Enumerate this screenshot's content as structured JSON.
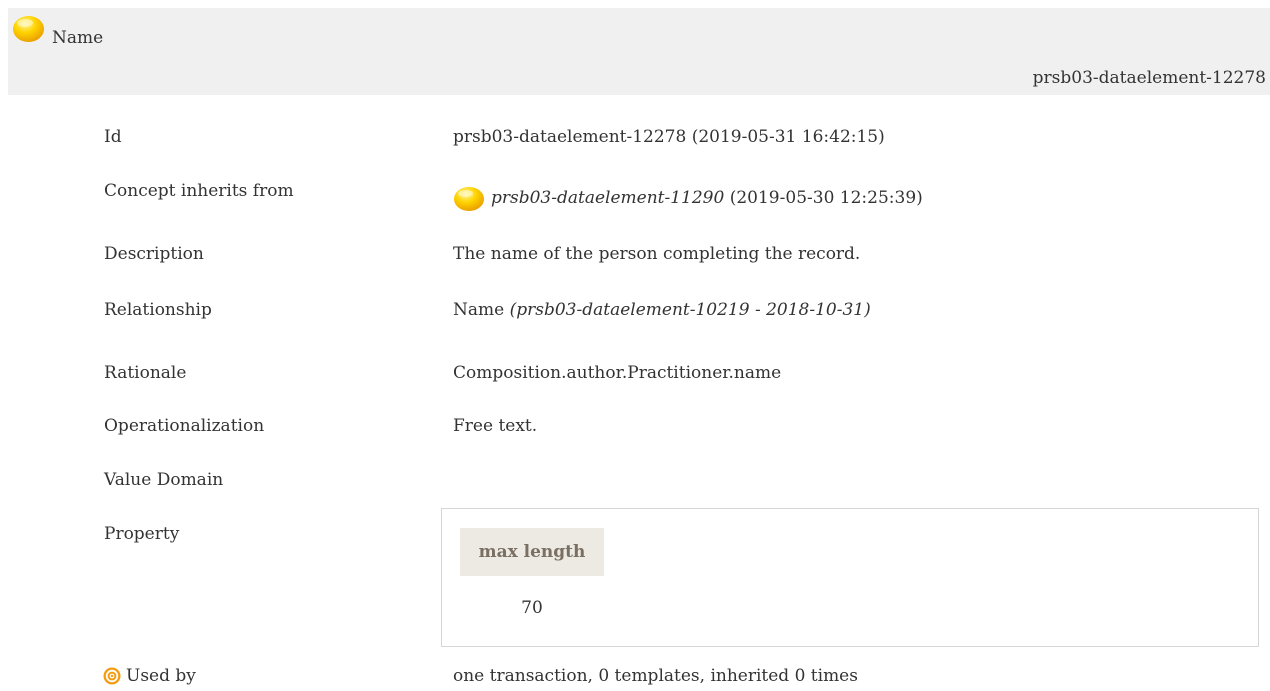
{
  "header": {
    "title": "Name",
    "id": "prsb03-dataelement-12278",
    "status_icon": "concept-status-orb-icon"
  },
  "rows": {
    "id": {
      "label": "Id",
      "value": "prsb03-dataelement-12278 (2019-05-31 16:42:15)"
    },
    "inherits": {
      "label": "Concept inherits from",
      "link": "prsb03-dataelement-11290",
      "date": " (2019-05-30 12:25:39)",
      "icon": "concept-status-orb-icon"
    },
    "description": {
      "label": "Description",
      "value": "The name of the person completing the record."
    },
    "relationship": {
      "label": "Relationship",
      "name": "Name ",
      "ref": "(prsb03-dataelement-10219 - 2018-10-31)"
    },
    "rationale": {
      "label": "Rationale",
      "value": "Composition.author.Practitioner.name"
    },
    "operationalization": {
      "label": "Operationalization",
      "value": "Free text."
    },
    "value_domain": {
      "label": "Value Domain"
    },
    "property": {
      "label": "Property",
      "table_header": "max length",
      "table_value": "70"
    },
    "used_by": {
      "label": "Used by",
      "value": "one transaction, 0 templates, inherited 0 times",
      "icon": "target-icon"
    }
  },
  "colors": {
    "header_bg": "#f0f0f0",
    "orb_yellow": "#ffd400",
    "orb_orange": "#f0a800",
    "target_orange": "#f39c12",
    "prop_header_bg": "#ede9e3",
    "prop_header_text": "#7a6f63"
  }
}
